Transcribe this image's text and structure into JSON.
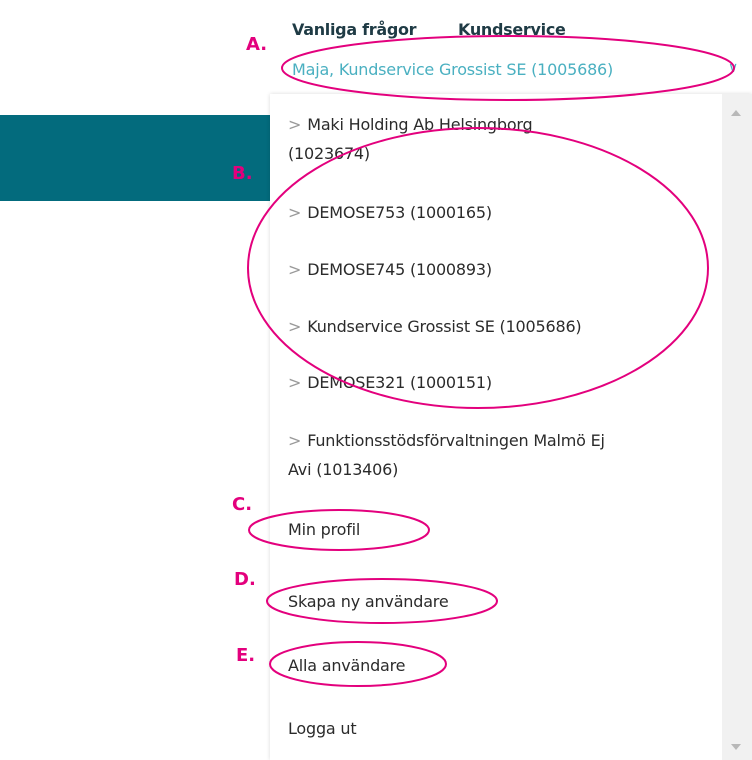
{
  "topnav": {
    "faq": "Vanliga frågor",
    "service": "Kundservice"
  },
  "account_selector": {
    "value": "Maja, Kundservice Grossist SE (1005686)"
  },
  "menu": {
    "companies": [
      {
        "line1": "Maki Holding Ab Helsingborg",
        "line2": "(1023674)"
      },
      {
        "line1": "DEMOSE753 (1000165)"
      },
      {
        "line1": "DEMOSE745 (1000893)"
      },
      {
        "line1": "Kundservice Grossist SE (1005686)"
      },
      {
        "line1": "DEMOSE321 (1000151)"
      },
      {
        "line1": "Funktionsstödsförvaltningen Malmö Ej",
        "line2": "Avi (1013406)"
      }
    ],
    "chevron": ">",
    "profile": "Min profil",
    "create_user": "Skapa ny användare",
    "all_users": "Alla användare",
    "logout": "Logga ut"
  },
  "annotations": {
    "a": "A.",
    "b": "B.",
    "c": "C.",
    "d": "D.",
    "e": "E."
  },
  "colors": {
    "teal": "#036b7d",
    "link": "#4ab0c1",
    "annotation": "#e3007d"
  }
}
